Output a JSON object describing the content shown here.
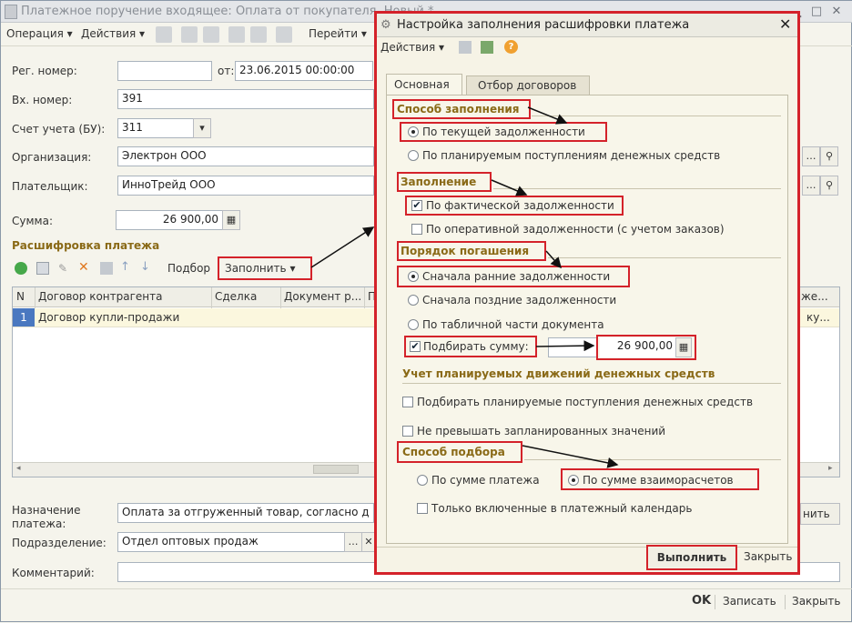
{
  "window": {
    "title": "Платежное поручение входящее: Оплата от покупателя. Новый *",
    "menu": [
      "Операция",
      "Действия",
      "Перейти"
    ],
    "form": {
      "reg_number_label": "Рег. номер:",
      "reg_number_value": "",
      "date_label": "от:",
      "date_value": "23.06.2015 00:00:00",
      "in_number_label": "Вх. номер:",
      "in_number_value": "391",
      "account_label": "Счет учета (БУ):",
      "account_value": "311",
      "org_label": "Организация:",
      "org_value": "Электрон ООО",
      "payer_label": "Плательщик:",
      "payer_value": "ИнноТрейд ООО",
      "sum_label": "Сумма:",
      "sum_value": "26 900,00",
      "breakdown_title": "Расшифровка платежа",
      "pick_label": "Подбор",
      "fill_label": "Заполнить",
      "purpose_label": "Назначение платежа:",
      "purpose_value": "Оплата за отгруженный товар, согласно д",
      "division_label": "Подразделение:",
      "division_value": "Отдел оптовых продаж",
      "comment_label": "Комментарий:",
      "comment_value": "",
      "partial_right_btn": "нить"
    },
    "grid": {
      "headers": [
        "N",
        "Договор контрагента",
        "Сделка",
        "Документ р...",
        "П",
        "же..."
      ],
      "rows": [
        {
          "n": "1",
          "contract": "Договор купли-продажи",
          "deal": "",
          "doc": "",
          "tail": "ку..."
        }
      ]
    },
    "footer": {
      "ok": "OK",
      "write": "Записать",
      "close": "Закрыть"
    }
  },
  "dialog": {
    "title": "Настройка заполнения расшифровки платежа",
    "actions_label": "Действия",
    "tabs": [
      "Основная",
      "Отбор договоров"
    ],
    "fill_method": {
      "title": "Способ заполнения",
      "options": [
        "По текущей задолженности",
        "По планируемым поступлениям денежных средств"
      ],
      "selected": 0
    },
    "filling": {
      "title": "Заполнение",
      "options": [
        "По фактической задолженности",
        "По оперативной задолженности (с учетом заказов)"
      ],
      "checked": [
        true,
        false
      ]
    },
    "repayment": {
      "title": "Порядок погашения",
      "options": [
        "Сначала ранние задолженности",
        "Сначала поздние задолженности",
        "По табличной части документа"
      ],
      "selected": 0
    },
    "pick_sum": {
      "label": "Подбирать сумму:",
      "checked": true,
      "value": "26 900,00"
    },
    "planned": {
      "title": "Учет планируемых движений денежных средств",
      "options": [
        "Подбирать планируемые поступления денежных средств",
        "Не превышать запланированных значений"
      ],
      "checked": [
        false,
        false
      ]
    },
    "pick_method": {
      "title": "Способ подбора",
      "options": [
        "По сумме платежа",
        "По сумме взаиморасчетов"
      ],
      "selected": 1,
      "calendar_only": "Только включенные в платежный календарь",
      "calendar_checked": false
    },
    "execute": "Выполнить",
    "close": "Закрыть"
  },
  "colors": {
    "highlight": "#d4222a",
    "section": "#8a6a17"
  }
}
